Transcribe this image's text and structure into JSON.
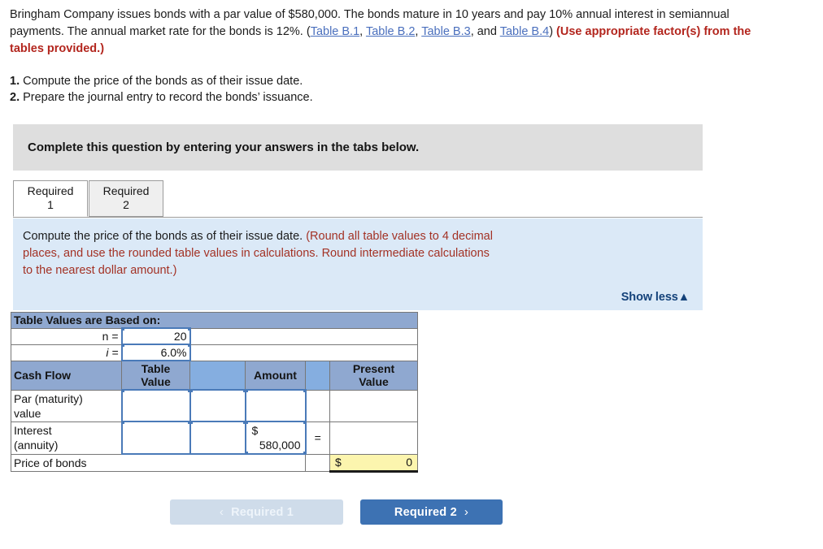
{
  "problem": {
    "text_1": "Bringham Company issues bonds with a par value of $580,000. The bonds mature in 10 years and pay 10% annual interest in semiannual payments. The annual market rate for the bonds is 12%. (",
    "link_1": "Table B.1",
    "sep_1": ", ",
    "link_2": "Table B.2",
    "sep_2": ", ",
    "link_3": "Table B.3",
    "sep_3": ", and ",
    "link_4": "Table B.4",
    "text_2": ") ",
    "note": "(Use appropriate factor(s) from the tables provided.)"
  },
  "requirements": [
    {
      "num": "1.",
      "text": " Compute the price of the bonds as of their issue date."
    },
    {
      "num": "2.",
      "text": " Prepare the journal entry to record the bonds’ issuance."
    }
  ],
  "gray_band": {
    "text": "Complete this question by entering your answers in the tabs below."
  },
  "tabs": [
    {
      "label_line1": "Required",
      "label_line2": "1",
      "active": true
    },
    {
      "label_line1": "Required",
      "label_line2": "2",
      "active": false
    }
  ],
  "blue_panel": {
    "prompt": "Compute the price of the bonds as of their issue date.",
    "rounding_1": " (Round all table values to 4 decimal",
    "rounding_2": "places, and use the rounded table values in calculations. Round intermediate calculations",
    "rounding_3": "to the nearest dollar amount.)",
    "show_less": "Show less▲"
  },
  "table": {
    "based_on_header": "Table Values are Based on:",
    "n_label": "n =",
    "n_value": "20",
    "i_label": "i =",
    "i_value": "6.0%",
    "columns": {
      "cash_flow": "Cash Flow",
      "table_value": "Table Value",
      "table_value_l1": "Table",
      "table_value_l2": "Value",
      "blank_1": "",
      "amount": "Amount",
      "blank_2": "",
      "present_value": "Present Value",
      "present_value_l1": "Present",
      "present_value_l2": "Value"
    },
    "rows": [
      {
        "cash_flow_l1": "Par (maturity)",
        "cash_flow_l2": "value",
        "table_value": "",
        "mid": "",
        "amount_dollar": "",
        "amount_value": "",
        "equals": "",
        "present_value": ""
      },
      {
        "cash_flow_l1": "Interest",
        "cash_flow_l2": "(annuity)",
        "table_value": "",
        "mid": "",
        "amount_dollar": "$",
        "amount_value": "580,000",
        "equals": "=",
        "present_value": ""
      }
    ],
    "total_row": {
      "label": "Price of bonds",
      "dollar": "$",
      "value": "0"
    }
  },
  "nav": {
    "prev_chevron": "‹",
    "prev_label": "Required 1",
    "next_label": "Required 2",
    "next_chevron": "›"
  },
  "colors": {
    "link_blue": "#4a6fbd",
    "red_note": "#b3261e",
    "rounding_red": "#a33225",
    "panel_blue": "#dbe9f7",
    "band_gray": "#dedede",
    "header_slate": "#8fa8d0",
    "header_light_blue": "#85aee0",
    "input_border": "#4a7ab8",
    "yellow_cell": "#fcf5ae",
    "button_blue": "#3d72b3",
    "button_disabled": "#cfdcea",
    "show_less_navy": "#14427a"
  }
}
